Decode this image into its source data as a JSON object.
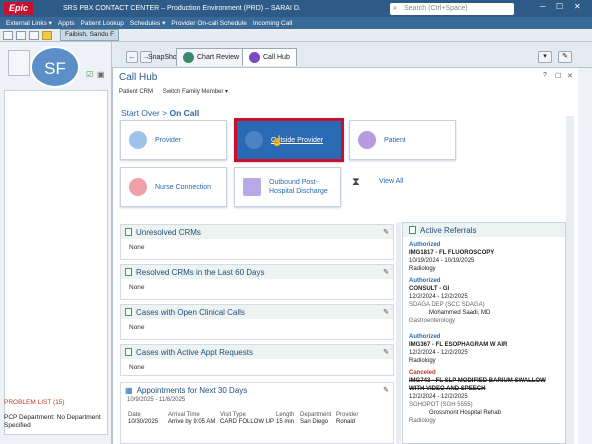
{
  "titlebar": {
    "logo": "Epic",
    "title": "SRS PBX CONTACT CENTER – Production Environment (PRD) – SARAI D.",
    "search_placeholder": "Search (Ctrl+Space)"
  },
  "menubar": {
    "items": [
      "External Links ▾",
      "Appts",
      "Patient Lookup",
      "Schedules ▾",
      "Provider On-call Schedule",
      "Incoming Call"
    ]
  },
  "patient_tab": "Faibish, Sandu F",
  "sidebar": {
    "initials": "SF",
    "problem_list": "PROBLEM LIST (15)",
    "pcp_department": "PCP Department: No Department Specified"
  },
  "activity_tabs": [
    {
      "label": "SnapShot"
    },
    {
      "label": "Chart Review"
    },
    {
      "label": "Call Hub"
    }
  ],
  "hub": {
    "title": "Call Hub",
    "tools": [
      "Patient CRM",
      "Switch Family Member ▾"
    ],
    "crumb_start": "Start Over",
    "crumb_sep": ">",
    "crumb_current": "On Call"
  },
  "tiles": {
    "provider": "Provider",
    "outside_provider": "Outside Provider",
    "patient": "Patient",
    "nurse": "Nurse Connection",
    "outbound": "Outbound Post-Hospital Discharge",
    "view_all": "View All"
  },
  "sections": [
    {
      "title": "Unresolved CRMs",
      "body": "None"
    },
    {
      "title": "Resolved CRMs in the Last 60 Days",
      "body": "None"
    },
    {
      "title": "Cases with Open Clinical Calls",
      "body": "None"
    },
    {
      "title": "Cases with Active Appt Requests",
      "body": "None"
    }
  ],
  "appointments": {
    "title": "Appointments for Next 30 Days",
    "range": "10/9/2025 - 11/8/2025",
    "headers": [
      "Date",
      "Arrival Time",
      "Visit Type",
      "Length",
      "Department",
      "Provider"
    ],
    "row": [
      "10/30/2025",
      "Arrive by 9:05 AM",
      "CARD FOLLOW UP",
      "15 min",
      "San Diego",
      "Ronald"
    ]
  },
  "referrals": {
    "title": "Active Referrals",
    "items": [
      {
        "status": "Authorized",
        "title": "IMG1817 - FL FLUOROSCOPY",
        "dates": "10/19/2024 - 10/19/2025",
        "dept": "Radiology"
      },
      {
        "status": "Authorized",
        "title": "CONSULT - GI",
        "dates": "12/2/2024 - 12/2/2025",
        "dept": "SDAGA DEP (SCC SDAGA)",
        "provider": "Mohammed Saadi, MD",
        "specialty": "Gastroenterology"
      },
      {
        "status": "Authorized",
        "title": "IMG367 - FL ESOPHAGRAM W AIR",
        "dates": "12/2/2024 - 12/2/2025",
        "dept": "Radiology"
      },
      {
        "status": "Canceled",
        "title": "IMG743 - FL SLP MODIFIED BARIUM SWALLOW WITH VIDEO AND SPEECH",
        "dates": "12/2/2024 - 12/2/2025",
        "dept": "SGHOPOT (SGH 5555)",
        "provider": "Grossmont Hospital Rehab",
        "specialty": "Radiology"
      }
    ]
  }
}
